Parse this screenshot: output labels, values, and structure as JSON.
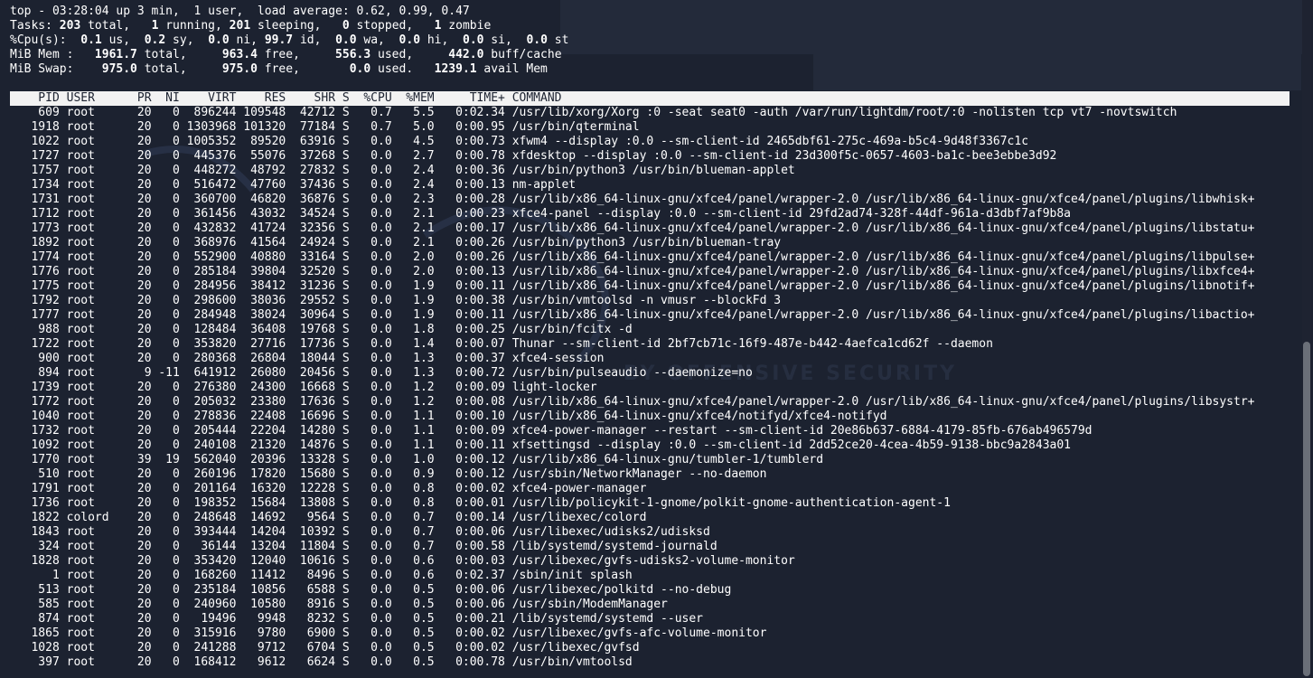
{
  "summary": {
    "top": "top - 03:28:04 up 3 min,  1 user,  load average: 0.62, 0.99, 0.47",
    "tasks": {
      "p0": "Tasks: ",
      "total": "203",
      "p1": " total,   ",
      "running": "1",
      "p2": " running, ",
      "sleeping": "201",
      "p3": " sleeping,   ",
      "stopped": "0",
      "p4": " stopped,   ",
      "zombie": "1",
      "p5": " zombie"
    },
    "cpu": {
      "p0": "%Cpu(s):  ",
      "us": "0.1",
      "p1": " us,  ",
      "sy": "0.2",
      "p2": " sy,  ",
      "ni": "0.0",
      "p3": " ni, ",
      "id": "99.7",
      "p4": " id,  ",
      "wa": "0.0",
      "p5": " wa,  ",
      "hi": "0.0",
      "p6": " hi,  ",
      "si": "0.0",
      "p7": " si,  ",
      "st": "0.0",
      "p8": " st"
    },
    "mem": {
      "p0": "MiB Mem :   ",
      "total": "1961.7",
      "p1": " total,     ",
      "free": "963.4",
      "p2": " free,     ",
      "used": "556.3",
      "p3": " used,     ",
      "buff": "442.0",
      "p4": " buff/cache"
    },
    "swap": {
      "p0": "MiB Swap:    ",
      "total": "975.0",
      "p1": " total,     ",
      "free": "975.0",
      "p2": " free,       ",
      "used": "0.0",
      "p3": " used.   ",
      "avail": "1239.1",
      "p4": " avail Mem"
    }
  },
  "table": {
    "header": "    PID USER      PR  NI    VIRT    RES    SHR S  %CPU  %MEM     TIME+ COMMAND",
    "rows": [
      "    609 root      20   0  896244 109548  42712 S   0.7   5.5   0:02.34 /usr/lib/xorg/Xorg :0 -seat seat0 -auth /var/run/lightdm/root/:0 -nolisten tcp vt7 -novtswitch",
      "   1918 root      20   0 1303968 101320  77184 S   0.7   5.0   0:00.95 /usr/bin/qterminal",
      "   1022 root      20   0 1005352  89520  63916 S   0.0   4.5   0:00.73 xfwm4 --display :0.0 --sm-client-id 2465dbf61-275c-469a-b5c4-9d48f3367c1c",
      "   1727 root      20   0  445376  55076  37268 S   0.0   2.7   0:00.78 xfdesktop --display :0.0 --sm-client-id 23d300f5c-0657-4603-ba1c-bee3ebbe3d92",
      "   1757 root      20   0  448272  48792  27832 S   0.0   2.4   0:00.36 /usr/bin/python3 /usr/bin/blueman-applet",
      "   1734 root      20   0  516472  47760  37436 S   0.0   2.4   0:00.13 nm-applet",
      "   1731 root      20   0  360700  46820  36876 S   0.0   2.3   0:00.28 /usr/lib/x86_64-linux-gnu/xfce4/panel/wrapper-2.0 /usr/lib/x86_64-linux-gnu/xfce4/panel/plugins/libwhisk+",
      "   1712 root      20   0  361456  43032  34524 S   0.0   2.1   0:00.23 xfce4-panel --display :0.0 --sm-client-id 29fd2ad74-328f-44df-961a-d3dbf7af9b8a",
      "   1773 root      20   0  432832  41724  32356 S   0.0   2.1   0:00.17 /usr/lib/x86_64-linux-gnu/xfce4/panel/wrapper-2.0 /usr/lib/x86_64-linux-gnu/xfce4/panel/plugins/libstatu+",
      "   1892 root      20   0  368976  41564  24924 S   0.0   2.1   0:00.26 /usr/bin/python3 /usr/bin/blueman-tray",
      "   1774 root      20   0  552900  40880  33164 S   0.0   2.0   0:00.26 /usr/lib/x86_64-linux-gnu/xfce4/panel/wrapper-2.0 /usr/lib/x86_64-linux-gnu/xfce4/panel/plugins/libpulse+",
      "   1776 root      20   0  285184  39804  32520 S   0.0   2.0   0:00.13 /usr/lib/x86_64-linux-gnu/xfce4/panel/wrapper-2.0 /usr/lib/x86_64-linux-gnu/xfce4/panel/plugins/libxfce4+",
      "   1775 root      20   0  284956  38412  31236 S   0.0   1.9   0:00.11 /usr/lib/x86_64-linux-gnu/xfce4/panel/wrapper-2.0 /usr/lib/x86_64-linux-gnu/xfce4/panel/plugins/libnotif+",
      "   1792 root      20   0  298600  38036  29552 S   0.0   1.9   0:00.38 /usr/bin/vmtoolsd -n vmusr --blockFd 3",
      "   1777 root      20   0  284948  38024  30964 S   0.0   1.9   0:00.11 /usr/lib/x86_64-linux-gnu/xfce4/panel/wrapper-2.0 /usr/lib/x86_64-linux-gnu/xfce4/panel/plugins/libactio+",
      "    988 root      20   0  128484  36408  19768 S   0.0   1.8   0:00.25 /usr/bin/fcitx -d",
      "   1722 root      20   0  353820  27716  17736 S   0.0   1.4   0:00.07 Thunar --sm-client-id 2bf7cb71c-16f9-487e-b442-4aefca1cd62f --daemon",
      "    900 root      20   0  280368  26804  18044 S   0.0   1.3   0:00.37 xfce4-session",
      "    894 root       9 -11  641912  26080  20456 S   0.0   1.3   0:00.72 /usr/bin/pulseaudio --daemonize=no",
      "   1739 root      20   0  276380  24300  16668 S   0.0   1.2   0:00.09 light-locker",
      "   1772 root      20   0  205032  23380  17636 S   0.0   1.2   0:00.08 /usr/lib/x86_64-linux-gnu/xfce4/panel/wrapper-2.0 /usr/lib/x86_64-linux-gnu/xfce4/panel/plugins/libsystr+",
      "   1040 root      20   0  278836  22408  16696 S   0.0   1.1   0:00.10 /usr/lib/x86_64-linux-gnu/xfce4/notifyd/xfce4-notifyd",
      "   1732 root      20   0  205444  22204  14280 S   0.0   1.1   0:00.09 xfce4-power-manager --restart --sm-client-id 20e86b637-6884-4179-85fb-676ab496579d",
      "   1092 root      20   0  240108  21320  14876 S   0.0   1.1   0:00.11 xfsettingsd --display :0.0 --sm-client-id 2dd52ce20-4cea-4b59-9138-bbc9a2843a01",
      "   1770 root      39  19  562040  20396  13328 S   0.0   1.0   0:00.12 /usr/lib/x86_64-linux-gnu/tumbler-1/tumblerd",
      "    510 root      20   0  260196  17820  15680 S   0.0   0.9   0:00.12 /usr/sbin/NetworkManager --no-daemon",
      "   1791 root      20   0  201164  16320  12228 S   0.0   0.8   0:00.02 xfce4-power-manager",
      "   1736 root      20   0  198352  15684  13808 S   0.0   0.8   0:00.01 /usr/lib/policykit-1-gnome/polkit-gnome-authentication-agent-1",
      "   1822 colord    20   0  248648  14692   9564 S   0.0   0.7   0:00.14 /usr/libexec/colord",
      "   1843 root      20   0  393444  14204  10392 S   0.0   0.7   0:00.06 /usr/libexec/udisks2/udisksd",
      "    324 root      20   0   36144  13204  11804 S   0.0   0.7   0:00.58 /lib/systemd/systemd-journald",
      "   1828 root      20   0  353420  12040  10616 S   0.0   0.6   0:00.03 /usr/libexec/gvfs-udisks2-volume-monitor",
      "      1 root      20   0  168260  11412   8496 S   0.0   0.6   0:02.37 /sbin/init splash",
      "    513 root      20   0  235184  10856   6588 S   0.0   0.5   0:00.06 /usr/libexec/polkitd --no-debug",
      "    585 root      20   0  240960  10580   8916 S   0.0   0.5   0:00.06 /usr/sbin/ModemManager",
      "    874 root      20   0   19496   9948   8232 S   0.0   0.5   0:00.21 /lib/systemd/systemd --user",
      "   1865 root      20   0  315916   9780   6900 S   0.0   0.5   0:00.02 /usr/libexec/gvfs-afc-volume-monitor",
      "   1028 root      20   0  241288   9712   6704 S   0.0   0.5   0:00.02 /usr/libexec/gvfsd",
      "    397 root      20   0  168412   9612   6624 S   0.0   0.5   0:00.78 /usr/bin/vmtoolsd"
    ]
  },
  "colors": {
    "background": "#1c2230",
    "foreground": "#ffffff",
    "header_bg": "#f2f2f2"
  }
}
